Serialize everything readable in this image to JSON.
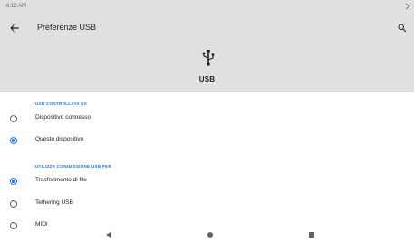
{
  "status_bar": {
    "time": "6:12 AM"
  },
  "app_bar": {
    "title": "Preferenze USB",
    "back_icon": "arrow-back-icon",
    "search_icon": "search-icon"
  },
  "header": {
    "icon": "usb-icon",
    "label": "USB"
  },
  "sections": [
    {
      "title": "USB CONTROLLATA DA",
      "options": [
        {
          "label": "Dispositivo connesso",
          "checked": false
        },
        {
          "label": "Questo dispositivo",
          "checked": true
        }
      ]
    },
    {
      "title": "UTILIZZA CONNESSIONE USB PER",
      "options": [
        {
          "label": "Trasferimento di file",
          "checked": true
        },
        {
          "label": "Tethering USB",
          "checked": false
        },
        {
          "label": "MIDI",
          "checked": false
        }
      ]
    }
  ],
  "nav_bar": {
    "back": "nav-back-icon",
    "home": "nav-home-icon",
    "recents": "nav-recents-icon"
  },
  "colors": {
    "accent": "#1a73e8",
    "header_bg": "#e0e0e0",
    "text": "#202124"
  }
}
